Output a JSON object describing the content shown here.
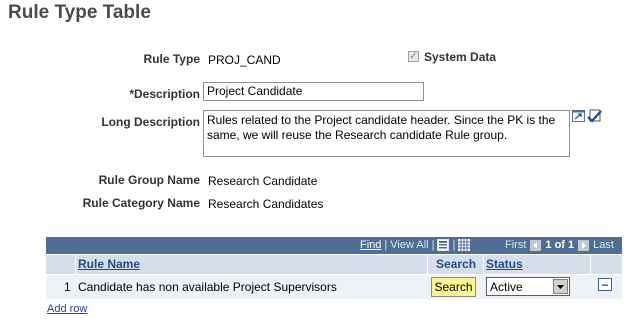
{
  "page": {
    "title": "Rule Type Table"
  },
  "form": {
    "rule_type_label": "Rule Type",
    "rule_type_value": "PROJ_CAND",
    "system_data_label": "System Data",
    "system_data_checked": true,
    "description_label": "*Description",
    "description_value": "Project Candidate",
    "long_description_label": "Long Description",
    "long_description_value": "Rules related to the Project candidate header. Since the PK is the same, we will reuse the Research candidate Rule group.",
    "rule_group_name_label": "Rule Group Name",
    "rule_group_name_value": "Research Candidate",
    "rule_category_name_label": "Rule Category Name",
    "rule_category_name_value": "Research Candidates"
  },
  "grid": {
    "find_label": "Find",
    "separator": "|",
    "view_all_label": "View All",
    "first_label": "First",
    "range_label": "1 of 1",
    "last_label": "Last",
    "columns": {
      "rule_name": "Rule Name",
      "search": "Search",
      "status": "Status"
    },
    "rows": [
      {
        "num": "1",
        "rule_name": "Candidate has non available Project Supervisors",
        "search_label": "Search",
        "status": "Active",
        "delete_symbol": "−"
      }
    ],
    "add_row_label": "Add row"
  },
  "icons": {
    "zoom": "popup-zoom-icon",
    "spell": "spell-check-icon",
    "download": "download-grid-icon",
    "viewgrid": "view-grid-icon",
    "first": "prev-arrow-icon",
    "last": "next-arrow-icon",
    "delete": "delete-row-icon"
  },
  "colors": {
    "grid_header": "#4e6e96",
    "column_header": "#d6dfe9",
    "button_bg": "#fbf592",
    "title": "#4b4b4b"
  }
}
